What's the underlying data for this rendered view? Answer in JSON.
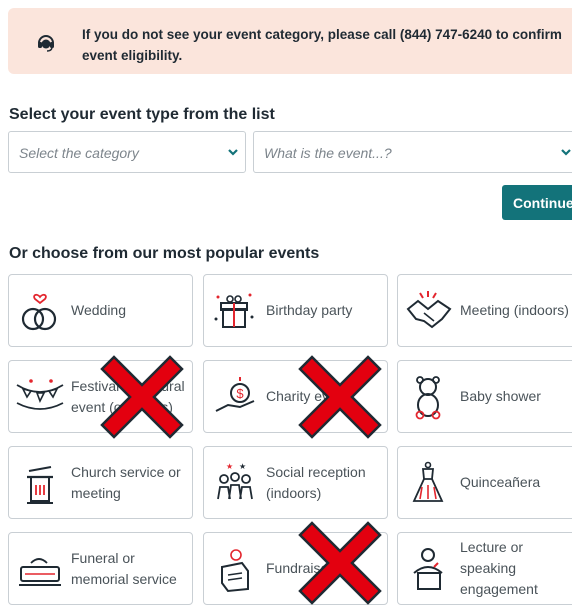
{
  "notice": {
    "icon": "headset-icon",
    "text": "If you do not see your event category, please call (844) 747-6240 to confirm event eligibility."
  },
  "select_heading": "Select your event type from the list",
  "category_select": {
    "placeholder": "Select the category",
    "icon": "chevron-down-icon"
  },
  "event_input": {
    "placeholder": "What is the event...?",
    "icon": "chevron-down-icon"
  },
  "continue_label": "Continue",
  "popular_heading": "Or choose from our most popular events",
  "events": [
    {
      "label": "Wedding",
      "icon": "wedding-rings-icon"
    },
    {
      "label": "Birthday party",
      "icon": "gift-icon"
    },
    {
      "label": "Meeting (indoors)",
      "icon": "handshake-icon"
    },
    {
      "label": "Festival or cultural event (outdoors)",
      "icon": "bunting-icon",
      "crossed_out": true
    },
    {
      "label": "Charity event",
      "icon": "charity-hand-icon",
      "crossed_out": true
    },
    {
      "label": "Baby shower",
      "icon": "teddy-bear-icon"
    },
    {
      "label": "Church service or meeting",
      "icon": "pulpit-icon"
    },
    {
      "label": "Social reception (indoors)",
      "icon": "people-party-icon"
    },
    {
      "label": "Quinceañera",
      "icon": "dress-icon"
    },
    {
      "label": "Funeral or memorial service",
      "icon": "casket-icon"
    },
    {
      "label": "Fundraiser",
      "icon": "donation-box-icon",
      "crossed_out": true
    },
    {
      "label": "Lecture or speaking engagement",
      "icon": "podium-speaker-icon"
    }
  ],
  "colors": {
    "notice_bg": "#fbe5dc",
    "accent": "#13737a",
    "cross": "#e3000f"
  }
}
